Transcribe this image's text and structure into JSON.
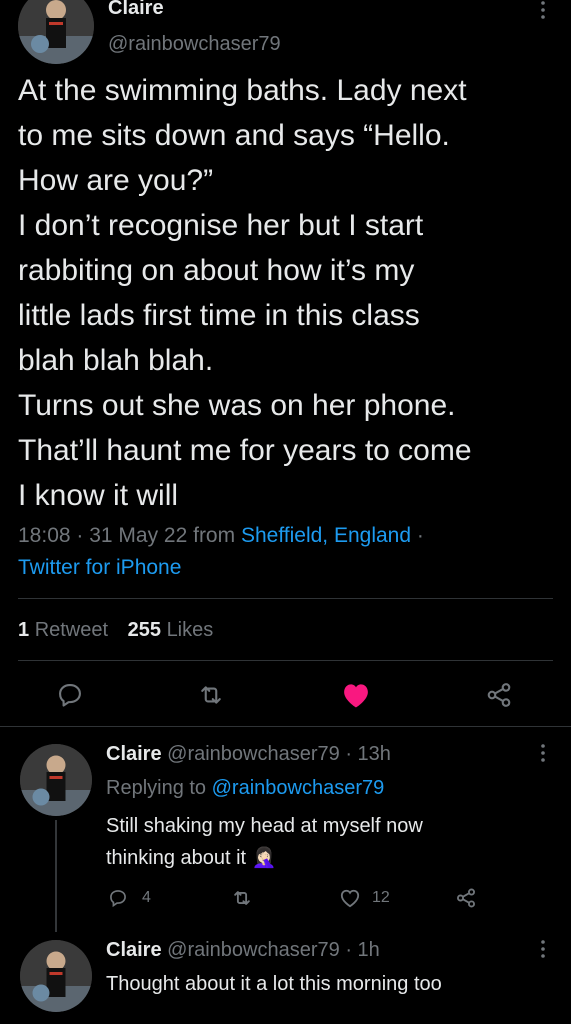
{
  "tweet": {
    "display_name": "Claire",
    "handle": "@rainbowchaser79",
    "text_lines": [
      "At the swimming baths. Lady next",
      "to me sits down and says “Hello.",
      "How are you?”",
      "I don’t recognise her but I start",
      "rabbiting on about how it’s my",
      "little lads first time in this class",
      "blah blah blah.",
      "Turns out she was on her phone.",
      "That’ll haunt me for years to come",
      "I know it will"
    ],
    "time": "18:08 · 31 May 22 from",
    "location": "Sheffield, England",
    "location_suffix": "·",
    "source": "Twitter for iPhone",
    "retweet_count": "1",
    "retweet_label": "Retweet",
    "like_count": "255",
    "like_label": "Likes"
  },
  "replies": [
    {
      "name": "Claire",
      "handle_time": "@rainbowchaser79 · 13h",
      "replying_prefix": "Replying to",
      "replying_handle": "@rainbowchaser79",
      "text_line1": "Still shaking my head at myself now",
      "text_line2": "thinking about it",
      "emoji": "🤦🏻‍♀️",
      "reply_count": "4",
      "retweet_count": "",
      "like_count": "12"
    },
    {
      "name": "Claire",
      "handle_time": "@rainbowchaser79 · 1h",
      "text_line1": "Thought about it a lot this morning too"
    }
  ],
  "colors": {
    "accent": "#1d9bf0",
    "like": "#f91880",
    "muted": "#71767b"
  },
  "icons": [
    "more-icon",
    "reply-icon",
    "retweet-icon",
    "heart-filled-icon",
    "share-icon",
    "heart-outline-icon"
  ]
}
